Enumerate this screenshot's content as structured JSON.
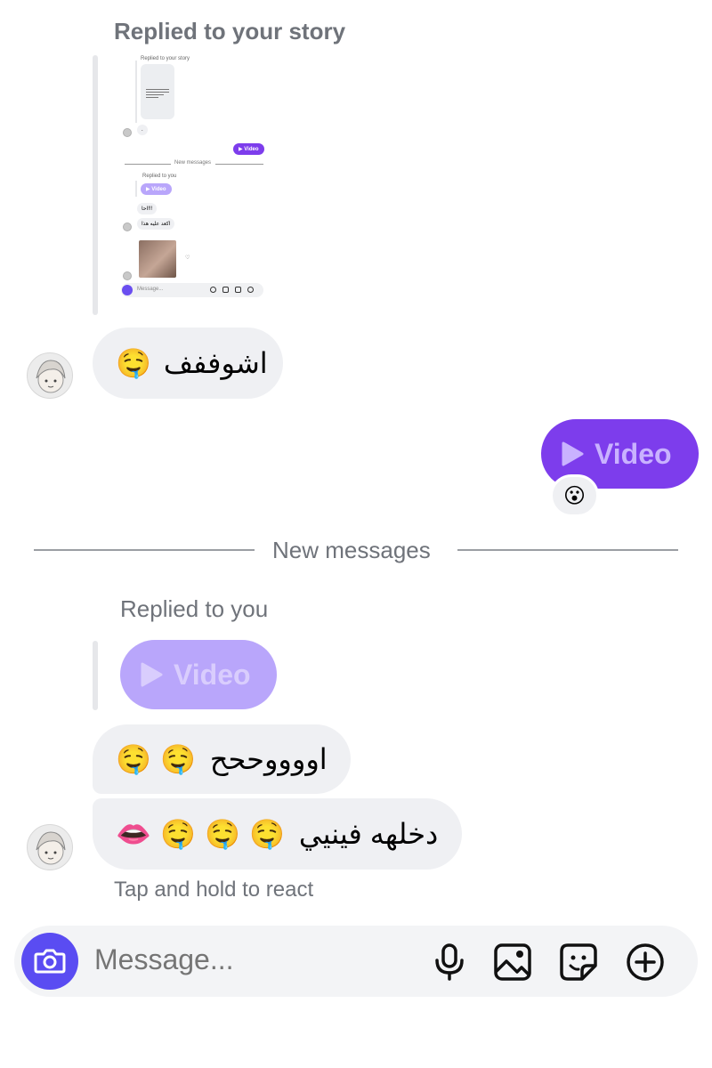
{
  "story_reply": {
    "header": "Replied to your story",
    "thumbnail": {
      "header": "Replied to your story",
      "dot": ".",
      "video_label": "Video",
      "new_messages": "New messages",
      "replied_to_you": "Replied to you",
      "video_label_2": "Video",
      "msg1": "احا!!!",
      "msg2": "اكعد عليه هذا",
      "input_placeholder": "Message..."
    }
  },
  "messages": {
    "incoming_1": {
      "text": "اشوففف",
      "emoji": "🤤"
    },
    "outgoing_video": {
      "label": "Video",
      "reaction": "😮"
    },
    "divider": "New messages",
    "reply_header": "Replied to you",
    "quoted_video": "Video",
    "incoming_2": {
      "text": "اووووححح",
      "emoji": "🤤 🤤"
    },
    "incoming_3": {
      "text": "دخلهه فينيي",
      "emoji": "👄 🤤 🤤 🤤"
    },
    "hint": "Tap and hold to react"
  },
  "composer": {
    "placeholder": "Message...",
    "icons": [
      "camera-icon",
      "microphone-icon",
      "gallery-icon",
      "sticker-icon",
      "plus-icon"
    ]
  },
  "colors": {
    "accent": "#7d3dec",
    "accent_light": "#b9a6fb",
    "camera": "#5a4cf2",
    "bubble": "#eff0f3",
    "muted_text": "#6f737a"
  }
}
